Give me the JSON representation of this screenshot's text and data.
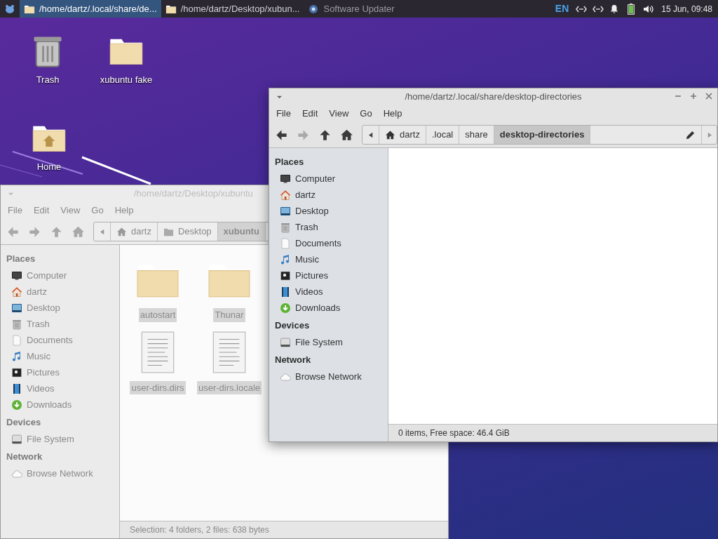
{
  "taskbar": {
    "tasks": [
      {
        "label": "/home/dartz/.local/share/de...",
        "kind": "folder",
        "selected": true
      },
      {
        "label": "/home/dartz/Desktop/xubun...",
        "kind": "folder",
        "selected": false
      },
      {
        "label": "Software Updater",
        "kind": "updater",
        "selected": false
      }
    ],
    "keyboard_layout": "EN",
    "clock": "15 Jun, 09:48"
  },
  "desktop_icons": [
    {
      "label": "Trash",
      "kind": "trash"
    },
    {
      "label": "xubuntu fake",
      "kind": "folder"
    },
    {
      "label": "Home",
      "kind": "home-folder"
    }
  ],
  "windows": [
    {
      "title": "/home/dartz/Desktop/xubuntu",
      "active": false,
      "menu": [
        "File",
        "Edit",
        "View",
        "Go",
        "Help"
      ],
      "nav": [
        {
          "kind": "back",
          "disabled": false
        },
        {
          "kind": "forward",
          "disabled": false
        },
        {
          "kind": "up",
          "disabled": false
        },
        {
          "kind": "home",
          "disabled": false
        }
      ],
      "breadcrumbs": [
        {
          "label": "dartz",
          "kind": "home",
          "selected": false
        },
        {
          "label": "Desktop",
          "kind": "folder",
          "selected": false
        },
        {
          "label": "xubuntu",
          "kind": "plain",
          "selected": true
        }
      ],
      "sidebar": [
        {
          "heading": "Places",
          "items": [
            {
              "label": "Computer",
              "kind": "computer"
            },
            {
              "label": "dartz",
              "kind": "home"
            },
            {
              "label": "Desktop",
              "kind": "desktop"
            },
            {
              "label": "Trash",
              "kind": "trash"
            },
            {
              "label": "Documents",
              "kind": "document"
            },
            {
              "label": "Music",
              "kind": "music"
            },
            {
              "label": "Pictures",
              "kind": "pictures"
            },
            {
              "label": "Videos",
              "kind": "videos"
            },
            {
              "label": "Downloads",
              "kind": "downloads"
            }
          ]
        },
        {
          "heading": "Devices",
          "items": [
            {
              "label": "File System",
              "kind": "drive"
            }
          ]
        },
        {
          "heading": "Network",
          "items": [
            {
              "label": "Browse Network",
              "kind": "cloud"
            }
          ]
        }
      ],
      "files": [
        {
          "label": "autostart",
          "kind": "folder",
          "selected": true
        },
        {
          "label": "Thunar",
          "kind": "folder",
          "selected": true
        },
        {
          "label": "user-dirs.dirs",
          "kind": "text",
          "selected": true
        },
        {
          "label": "user-dirs.locale",
          "kind": "text",
          "selected": true
        }
      ],
      "status": "Selection: 4 folders, 2 files: 638 bytes"
    },
    {
      "title": "/home/dartz/.local/share/desktop-directories",
      "active": true,
      "menu": [
        "File",
        "Edit",
        "View",
        "Go",
        "Help"
      ],
      "nav": [
        {
          "kind": "back",
          "disabled": false
        },
        {
          "kind": "forward",
          "disabled": true
        },
        {
          "kind": "up",
          "disabled": false
        },
        {
          "kind": "home",
          "disabled": false
        }
      ],
      "breadcrumbs": [
        {
          "label": "dartz",
          "kind": "home",
          "selected": false
        },
        {
          "label": ".local",
          "kind": "plain",
          "selected": false
        },
        {
          "label": "share",
          "kind": "plain",
          "selected": false
        },
        {
          "label": "desktop-directories",
          "kind": "plain",
          "selected": true
        }
      ],
      "sidebar": [
        {
          "heading": "Places",
          "items": [
            {
              "label": "Computer",
              "kind": "computer"
            },
            {
              "label": "dartz",
              "kind": "home"
            },
            {
              "label": "Desktop",
              "kind": "desktop"
            },
            {
              "label": "Trash",
              "kind": "trash"
            },
            {
              "label": "Documents",
              "kind": "document"
            },
            {
              "label": "Music",
              "kind": "music"
            },
            {
              "label": "Pictures",
              "kind": "pictures"
            },
            {
              "label": "Videos",
              "kind": "videos"
            },
            {
              "label": "Downloads",
              "kind": "downloads"
            }
          ]
        },
        {
          "heading": "Devices",
          "items": [
            {
              "label": "File System",
              "kind": "drive"
            }
          ]
        },
        {
          "heading": "Network",
          "items": [
            {
              "label": "Browse Network",
              "kind": "cloud"
            }
          ]
        }
      ],
      "status": "0 items, Free space: 46.4 GiB"
    }
  ]
}
